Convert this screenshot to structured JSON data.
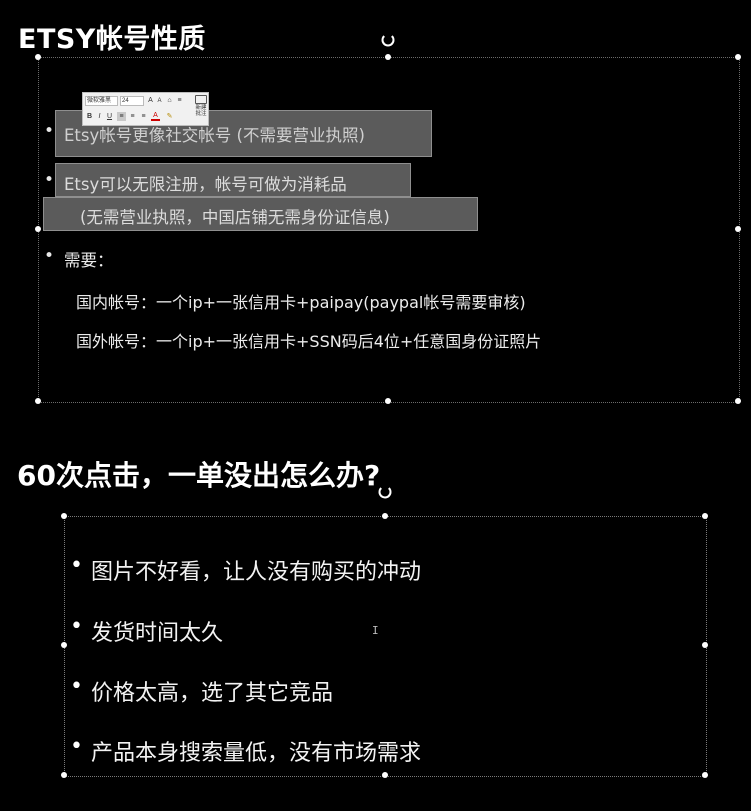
{
  "slide1": {
    "title": "ETSY帐号性质",
    "bullets": [
      "Etsy帐号更像社交帐号 (不需要营业执照)",
      "Etsy可以无限注册，帐号可做为消耗品",
      "(无需营业执照，中国店铺无需身份证信息)",
      "需要："
    ],
    "lines": [
      "国内帐号：一个ip+一张信用卡+paipay(paypal帐号需要审核)",
      "国外帐号：一个ip+一张信用卡+SSN码后4位+任意国身份证照片"
    ],
    "bullet_char": "•"
  },
  "toolbar": {
    "font_name": "微软雅黑",
    "font_size": "24",
    "grow_font": "A",
    "shrink_font": "A",
    "bold": "B",
    "italic": "I",
    "underline": "U",
    "font_color": "A",
    "new_comment": "新建批注"
  },
  "slide2": {
    "title": "60次点击，一单没出怎么办?",
    "bullets": [
      "图片不好看，让人没有购买的冲动",
      "发货时间太久",
      "价格太高，选了其它竞品",
      "产品本身搜索量低，没有市场需求"
    ]
  },
  "cursor_glyph": "I",
  "colors": {
    "background": "#000000",
    "text": "#ffffff",
    "highlight": "#5b5b5b",
    "frame": "#6b6b6b"
  }
}
